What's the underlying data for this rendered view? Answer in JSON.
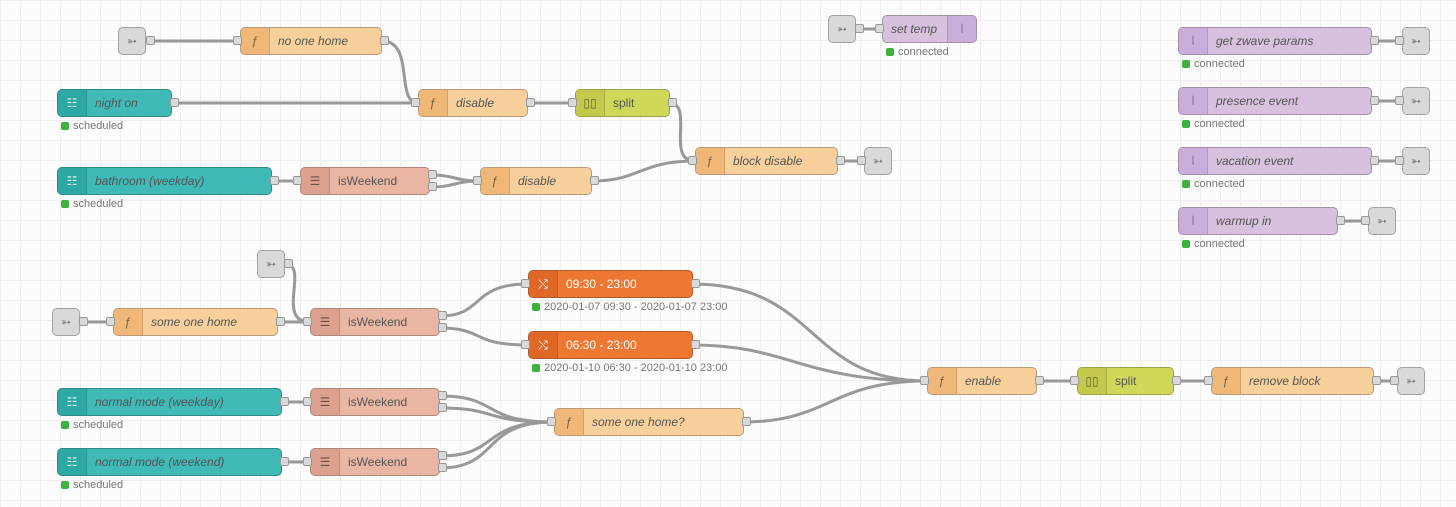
{
  "nodes": {
    "night_on": "night on",
    "bathroom_wd": "bathroom (weekday)",
    "normal_wd": "normal mode (weekday)",
    "normal_we": "normal mode (weekend)",
    "no_one_home": "no one home",
    "some_one_home": "some one home",
    "some_one_home_q": "some one home?",
    "disable1": "disable",
    "disable2": "disable",
    "block_disable": "block disable",
    "enable": "enable",
    "remove_block": "remove block",
    "split1": "split",
    "split2": "split",
    "is_we_1": "isWeekend",
    "is_we_2": "isWeekend",
    "is_we_3": "isWeekend",
    "is_we_4": "isWeekend",
    "t1": "09:30 - 23:00",
    "t2": "06:30 - 23:00",
    "set_temp": "set temp",
    "get_zw": "get zwave params",
    "pres": "presence event",
    "vac": "vacation event",
    "warm": "warmup in"
  },
  "status": {
    "scheduled": "scheduled",
    "connected": "connected",
    "t1": "2020-01-07 09:30 - 2020-01-07 23:00",
    "t2": "2020-01-10 06:30 - 2020-01-10 23:00"
  }
}
